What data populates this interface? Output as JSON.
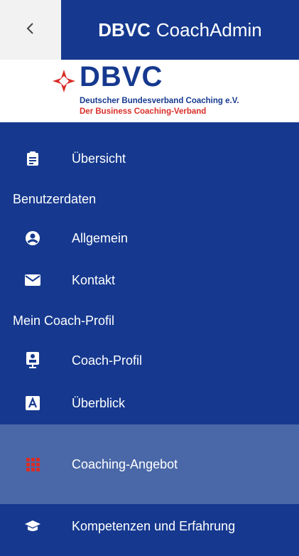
{
  "header": {
    "back_icon": "chevron-left-icon",
    "title_bold": "DBVC",
    "title_rest": "CoachAdmin"
  },
  "logo": {
    "name": "DBVC",
    "line1": "Deutscher Bundesverband Coaching e.V.",
    "line2": "Der Business Coaching-Verband"
  },
  "nav": {
    "overview": "Übersicht",
    "section_userdata": "Benutzerdaten",
    "general": "Allgemein",
    "contact": "Kontakt",
    "section_profile": "Mein Coach-Profil",
    "coach_profile": "Coach-Profil",
    "overview2": "Überblick",
    "coaching_offer": "Coaching-Angebot",
    "skills": "Kompetenzen und Erfahrung"
  },
  "colors": {
    "primary": "#16398f",
    "active_bg": "#4a68a7",
    "accent_red": "#d92d27"
  }
}
